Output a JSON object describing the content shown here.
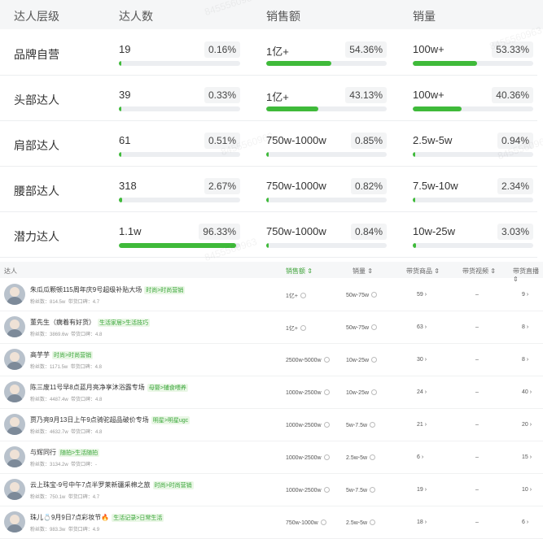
{
  "tier_table": {
    "headers": [
      "达人层级",
      "达人数",
      "销售额",
      "销量"
    ],
    "rows": [
      {
        "name": "品牌自营",
        "count": "19",
        "count_pct": "0.16%",
        "count_frac": 0.0016,
        "sales": "1亿+",
        "sales_pct": "54.36%",
        "sales_frac": 0.5436,
        "volume": "100w+",
        "volume_pct": "53.33%",
        "volume_frac": 0.5333
      },
      {
        "name": "头部达人",
        "count": "39",
        "count_pct": "0.33%",
        "count_frac": 0.0033,
        "sales": "1亿+",
        "sales_pct": "43.13%",
        "sales_frac": 0.4313,
        "volume": "100w+",
        "volume_pct": "40.36%",
        "volume_frac": 0.4036
      },
      {
        "name": "肩部达人",
        "count": "61",
        "count_pct": "0.51%",
        "count_frac": 0.0051,
        "sales": "750w-1000w",
        "sales_pct": "0.85%",
        "sales_frac": 0.0085,
        "volume": "2.5w-5w",
        "volume_pct": "0.94%",
        "volume_frac": 0.0094
      },
      {
        "name": "腰部达人",
        "count": "318",
        "count_pct": "2.67%",
        "count_frac": 0.0267,
        "sales": "750w-1000w",
        "sales_pct": "0.82%",
        "sales_frac": 0.0082,
        "volume": "7.5w-10w",
        "volume_pct": "2.34%",
        "volume_frac": 0.0234
      },
      {
        "name": "潜力达人",
        "count": "1.1w",
        "count_pct": "96.33%",
        "count_frac": 0.9633,
        "sales": "750w-1000w",
        "sales_pct": "0.84%",
        "sales_frac": 0.0084,
        "volume": "10w-25w",
        "volume_pct": "3.03%",
        "volume_frac": 0.0303
      }
    ]
  },
  "kol_table": {
    "headers": [
      "达人",
      "销售额 ⇕",
      "销量 ⇕",
      "带货商品 ⇕",
      "带货视频 ⇕",
      "带货直播 ⇕"
    ],
    "rows": [
      {
        "name": "朱瓜瓜颗顿115周年庆9号超级补贴大场",
        "tag": "时尚>时尚营销",
        "fans": "粉丝数：814.5w",
        "rating": "带货口碑：4.7",
        "sales": "1亿+",
        "volume": "50w-75w",
        "goods": "59 ›",
        "videos": "–",
        "lives": "9 ›"
      },
      {
        "name": "董先生（瘸着有好货）",
        "tag": "生活家居>生活技巧",
        "fans": "粉丝数：3869.6w",
        "rating": "带货口碑：4.8",
        "sales": "1亿+",
        "volume": "50w-75w",
        "goods": "63 ›",
        "videos": "–",
        "lives": "8 ›"
      },
      {
        "name": "高芋芋",
        "tag": "时尚>时尚营销",
        "fans": "粉丝数：1171.5w",
        "rating": "带货口碑：4.8",
        "sales": "2500w-5000w",
        "volume": "10w-25w",
        "goods": "30 ›",
        "videos": "–",
        "lives": "8 ›"
      },
      {
        "name": "陈三废11号早8点蓝月亮净享沐浴露专场",
        "tag": "母婴>辅食喂养",
        "fans": "粉丝数：4487.4w",
        "rating": "带货口碑：4.8",
        "sales": "1000w-2500w",
        "volume": "10w-25w",
        "goods": "24 ›",
        "videos": "–",
        "lives": "40 ›"
      },
      {
        "name": "贾乃亮9月13日上午9点骑驼超品破价专场",
        "tag": "明星>明星ugc",
        "fans": "粉丝数：4632.7w",
        "rating": "带货口碑：4.8",
        "sales": "1000w-2500w",
        "volume": "5w-7.5w",
        "goods": "21 ›",
        "videos": "–",
        "lives": "20 ›"
      },
      {
        "name": "与辉同行",
        "tag": "随拍>生活随拍",
        "fans": "粉丝数：3134.2w",
        "rating": "带货口碑：-",
        "sales": "1000w-2500w",
        "volume": "2.5w-5w",
        "goods": "6 ›",
        "videos": "–",
        "lives": "15 ›"
      },
      {
        "name": "云上珠宝-9号中午7点半罗莱新疆采棉之旅",
        "tag": "时尚>时尚营销",
        "fans": "粉丝数：750.1w",
        "rating": "带货口碑：4.7",
        "sales": "1000w-2500w",
        "volume": "5w-7.5w",
        "goods": "19 ›",
        "videos": "–",
        "lives": "10 ›"
      },
      {
        "name": "珠儿💍9月9日7点彩妆节🔥",
        "tag": "生活记录>日常生活",
        "fans": "粉丝数：983.3w",
        "rating": "带货口碑：4.9",
        "sales": "750w-1000w",
        "volume": "2.5w-5w",
        "goods": "18 ›",
        "videos": "–",
        "lives": "6 ›"
      }
    ]
  },
  "watermark": "8455560963",
  "colors": {
    "accent": "#3fba3a",
    "header_bg": "#f5f6f7",
    "tag_text": "#3aa63a"
  }
}
